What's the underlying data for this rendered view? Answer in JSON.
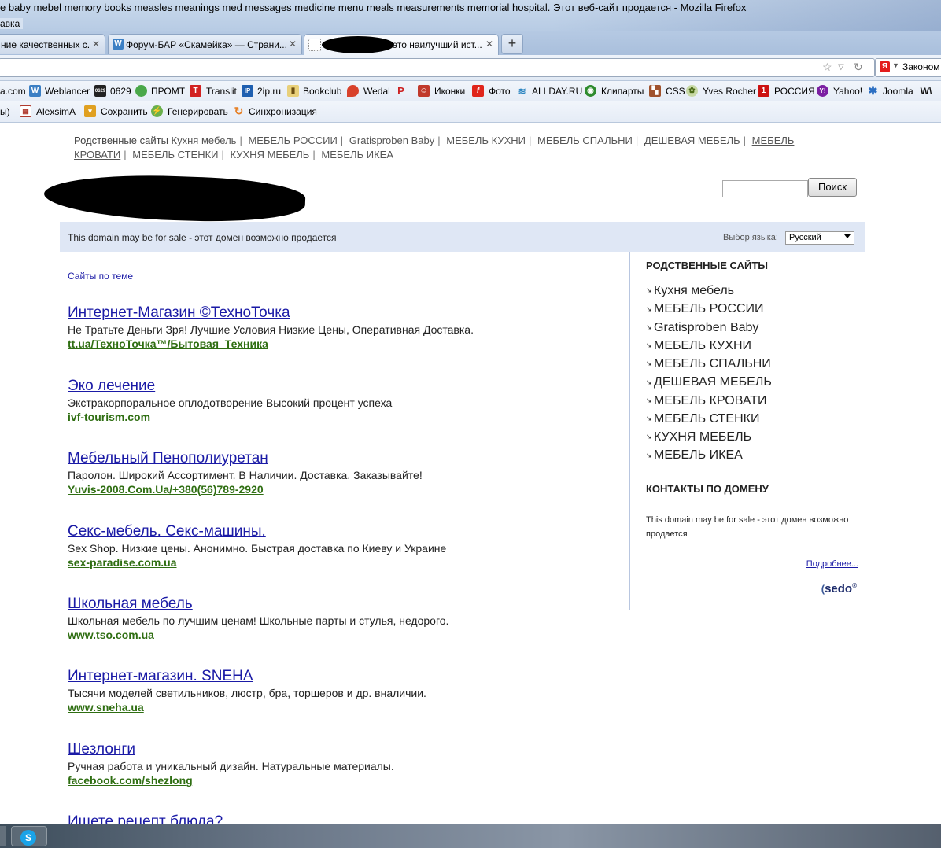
{
  "window": {
    "title": "e baby mebel memory books measles meanings med messages medicine menu meals measurements memorial hospital. Этот веб-сайт продается - Mozilla Firefox",
    "menu_fragment": "авка"
  },
  "tabs": [
    {
      "label": "ние качественных с...",
      "active": false
    },
    {
      "label": "Форум-БАР «Скамейка» — Страни...",
      "active": false
    },
    {
      "label": "это наилучший ист...",
      "active": true
    }
  ],
  "new_tab_label": "+",
  "search_bar": {
    "engine_icon": "Я",
    "value": "Законом"
  },
  "bookmarks_row1": [
    {
      "label": "a.com",
      "icon": "none"
    },
    {
      "label": "Weblancer",
      "icon": "W",
      "color": "#3b7fc4"
    },
    {
      "label": "0629",
      "icon": "0629",
      "color": "#222222"
    },
    {
      "label": "ПРОМТ",
      "icon": "promt",
      "color": "#4aa84a"
    },
    {
      "label": "Translit",
      "icon": "T",
      "color": "#d22222"
    },
    {
      "label": "2ip.ru",
      "icon": "IP",
      "color": "#1e5fb0"
    },
    {
      "label": "Bookclub",
      "icon": "book",
      "color": "#c8a234"
    },
    {
      "label": "Wedal",
      "icon": "pin",
      "color": "#d8412b"
    },
    {
      "label": "",
      "icon": "P",
      "color": "#cc2222"
    },
    {
      "label": "Иконки",
      "icon": "face",
      "color": "#c0392b"
    },
    {
      "label": "Фото",
      "icon": "f",
      "color": "#e0251b"
    },
    {
      "label": "ALLDAY.RU",
      "icon": "wave",
      "color": "#2e86c1"
    },
    {
      "label": "Клипарты",
      "icon": "clip",
      "color": "#2e8b2e"
    },
    {
      "label": "CSS",
      "icon": "css",
      "color": "#a0522d"
    },
    {
      "label": "Yves Rocher",
      "icon": "yr",
      "color": "#7aa33a"
    },
    {
      "label": "РОССИЯ",
      "icon": "1",
      "color": "#cc1111"
    },
    {
      "label": "Yahoo!",
      "icon": "Y!",
      "color": "#7b1fa2"
    },
    {
      "label": "Joomla",
      "icon": "joomla",
      "color": "#2a6ec2"
    },
    {
      "label": "",
      "icon": "WM",
      "color": "#111111"
    }
  ],
  "bookmarks_row2": [
    {
      "label": "ы)",
      "icon": "none"
    },
    {
      "label": "AlexsimA",
      "icon": "grid",
      "color": "#b03a2e"
    },
    {
      "label": "Сохранить",
      "icon": "save",
      "color": "#e0a020"
    },
    {
      "label": "Генерировать",
      "icon": "gen",
      "color": "#6ab04c"
    },
    {
      "label": "Синхронизация",
      "icon": "sync",
      "color": "#e67e22"
    }
  ],
  "top_links": {
    "first": "Родственные сайты",
    "items": [
      "Кухня мебель",
      "МЕБЕЛЬ РОССИИ",
      "Gratisproben Baby",
      "МЕБЕЛЬ КУХНИ",
      "МЕБЕЛЬ СПАЛЬНИ",
      "ДЕШЕВАЯ МЕБЕЛЬ",
      "МЕБЕЛЬ КРОВАТИ",
      "МЕБЕЛЬ СТЕНКИ",
      "КУХНЯ МЕБЕЛЬ",
      "МЕБЕЛЬ ИКЕА"
    ]
  },
  "site_search": {
    "button": "Поиск",
    "value": ""
  },
  "sale_band": {
    "text": "This domain may be for sale - этот домен возможно продается",
    "lang_label": "Выбор языка:",
    "lang_value": "Русский"
  },
  "sites_theme_label": "Сайты по теме",
  "ads": [
    {
      "title": "Интернет-Магазин ©ТехноТочка",
      "desc": "Не Тратьте Деньги Зря! Лучшие Условия Низкие Цены, Оперативная Доставка.",
      "url": "tt.ua/ТехноТочка™/Бытовая_Техника"
    },
    {
      "title": "Эко лечение",
      "desc": "Экстракорпоральное оплодотворение Высокий процент успеха",
      "url": "ivf-tourism.com"
    },
    {
      "title": "Мебельный Пенополиуретан",
      "desc": "Паролон. Широкий Ассортимент. В Наличии. Доставка. Заказывайте!",
      "url": "Yuvis-2008.Com.Ua/+380(56)789-2920"
    },
    {
      "title": "Секс-мебель. Секс-машины.",
      "desc": "Sex Shop. Низкие цены. Анонимно. Быстрая доставка по Киеву и Украине",
      "url": "sex-paradise.com.ua"
    },
    {
      "title": "Школьная мебель",
      "desc": "Школьная мебель по лучшим ценам! Школьные парты и стулья, недорого.",
      "url": "www.tso.com.ua"
    },
    {
      "title": "Интернет-магазин. SNEHA",
      "desc": "Тысячи моделей светильников, люстр, бра, торшеров и др. вналичии.",
      "url": "www.sneha.ua"
    },
    {
      "title": "Шезлонги",
      "desc": "Ручная работа и уникальный дизайн. Натуральные материалы.",
      "url": "facebook.com/shezlong"
    },
    {
      "title": "Ищете рецепт блюда?",
      "desc": "",
      "url": ""
    }
  ],
  "sidebar": {
    "heading": "РОДСТВЕННЫЕ САЙТЫ",
    "items": [
      "Кухня мебель",
      "МЕБЕЛЬ РОССИИ",
      "Gratisproben Baby",
      "МЕБЕЛЬ КУХНИ",
      "МЕБЕЛЬ СПАЛЬНИ",
      "ДЕШЕВАЯ МЕБЕЛЬ",
      "МЕБЕЛЬ КРОВАТИ",
      "МЕБЕЛЬ СТЕНКИ",
      "КУХНЯ МЕБЕЛЬ",
      "МЕБЕЛЬ ИКЕА"
    ],
    "contacts_heading": "КОНТАКТЫ ПО ДОМЕНУ",
    "contacts_text": "This domain may be for sale - этот домен возможно продается",
    "more_link": "Подробнее...",
    "logo": "sedo"
  },
  "colors": {
    "link": "#1a1aa6",
    "ad_url": "#2f6e12",
    "band": "#dfe7f5",
    "border": "#b8c6e0"
  }
}
